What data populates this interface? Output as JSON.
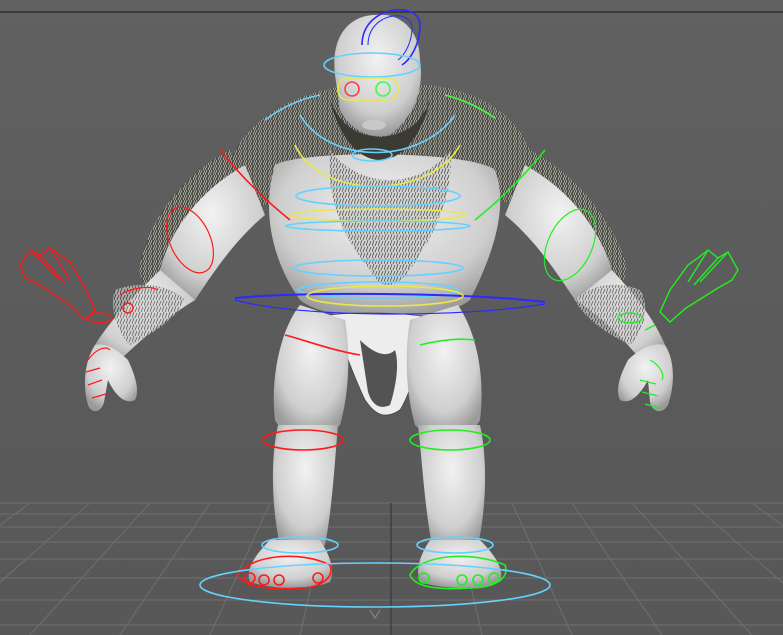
{
  "viewport": {
    "background_color": "#5a5a5a",
    "grid_color": "#6c6c6c",
    "horizon_color": "#3c3c3c"
  },
  "model": {
    "skin_color": "#d9d9d9",
    "fur_color": "#3a3a30"
  },
  "rig_colors": {
    "left_side": "#ff1a1a",
    "right_side": "#22ee22",
    "center_fk": "#66d0ff",
    "spine_ik": "#e8e84a",
    "root": "#2a2aff"
  },
  "controls": [
    {
      "name": "head-pivot-control",
      "color": "root"
    },
    {
      "name": "head-control",
      "color": "center_fk"
    },
    {
      "name": "eyes-control",
      "color": "spine_ik"
    },
    {
      "name": "neck-control",
      "color": "center_fk"
    },
    {
      "name": "chest-ik-control",
      "color": "spine_ik"
    },
    {
      "name": "spine-control",
      "color": "center_fk"
    },
    {
      "name": "hip-control",
      "color": "root"
    },
    {
      "name": "left-hand-ik-control",
      "color": "left_side"
    },
    {
      "name": "right-hand-ik-control",
      "color": "right_side"
    },
    {
      "name": "left-foot-control",
      "color": "left_side"
    },
    {
      "name": "right-foot-control",
      "color": "right_side"
    },
    {
      "name": "world-root-control",
      "color": "center_fk"
    }
  ]
}
